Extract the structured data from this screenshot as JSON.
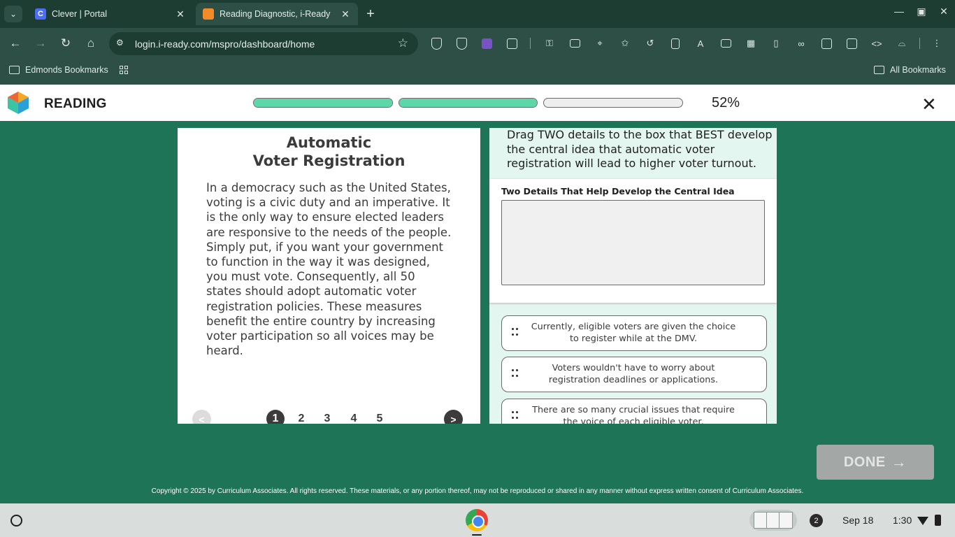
{
  "browser": {
    "tabs": [
      {
        "title": "Clever | Portal",
        "favicon": "C",
        "active": false
      },
      {
        "title": "Reading Diagnostic, i-Ready",
        "favicon": "",
        "active": true
      }
    ],
    "url": "login.i-ready.com/mspro/dashboard/home",
    "bookmarks": {
      "left_folder": "Edmonds Bookmarks",
      "right_folder": "All Bookmarks"
    }
  },
  "app": {
    "title": "READING",
    "progress": {
      "segments_filled": [
        1.0,
        1.0,
        0.0
      ],
      "percent_label": "52%"
    },
    "close_icon": "close-icon"
  },
  "passage": {
    "title_line1": "Automatic",
    "title_line2": "Voter Registration",
    "body": "In a democracy such as the United States, voting is a civic duty and an imperative. It is the only way to ensure elected leaders are responsive to the needs of the people. Simply put, if you want your government to function in the way it was designed, you must vote. Consequently, all 50 states should adopt automatic voter registration policies. These measures benefit the entire country by increasing voter participation so all voices may be heard.",
    "pager": {
      "prev": "<",
      "next": ">",
      "pages": [
        "1",
        "2",
        "3",
        "4",
        "5"
      ],
      "current": "1"
    }
  },
  "question": {
    "prompt": "Drag TWO details to the box that BEST develop the central idea that automatic voter registration will lead to higher voter turnout.",
    "dropzone_label": "Two Details That Help Develop the Central Idea",
    "choices": [
      "Currently, eligible voters are given the choice to register while at the DMV.",
      "Voters wouldn't have to worry about registration deadlines or applications.",
      "There are so many crucial issues that require the voice of each eligible voter."
    ]
  },
  "done_button": {
    "label": "DONE",
    "arrow": "→"
  },
  "copyright": "Copyright © 2025 by Curriculum Associates. All rights reserved. These materials, or any portion thereof, may not be reproduced or shared in any manner without express written consent of Curriculum Associates.",
  "shelf": {
    "notifications": "2",
    "date": "Sep 18",
    "time": "1:30"
  },
  "colors": {
    "accent_green": "#1d7456",
    "progress_fill": "#5dd6a8",
    "question_bg": "#e3f6ef"
  }
}
